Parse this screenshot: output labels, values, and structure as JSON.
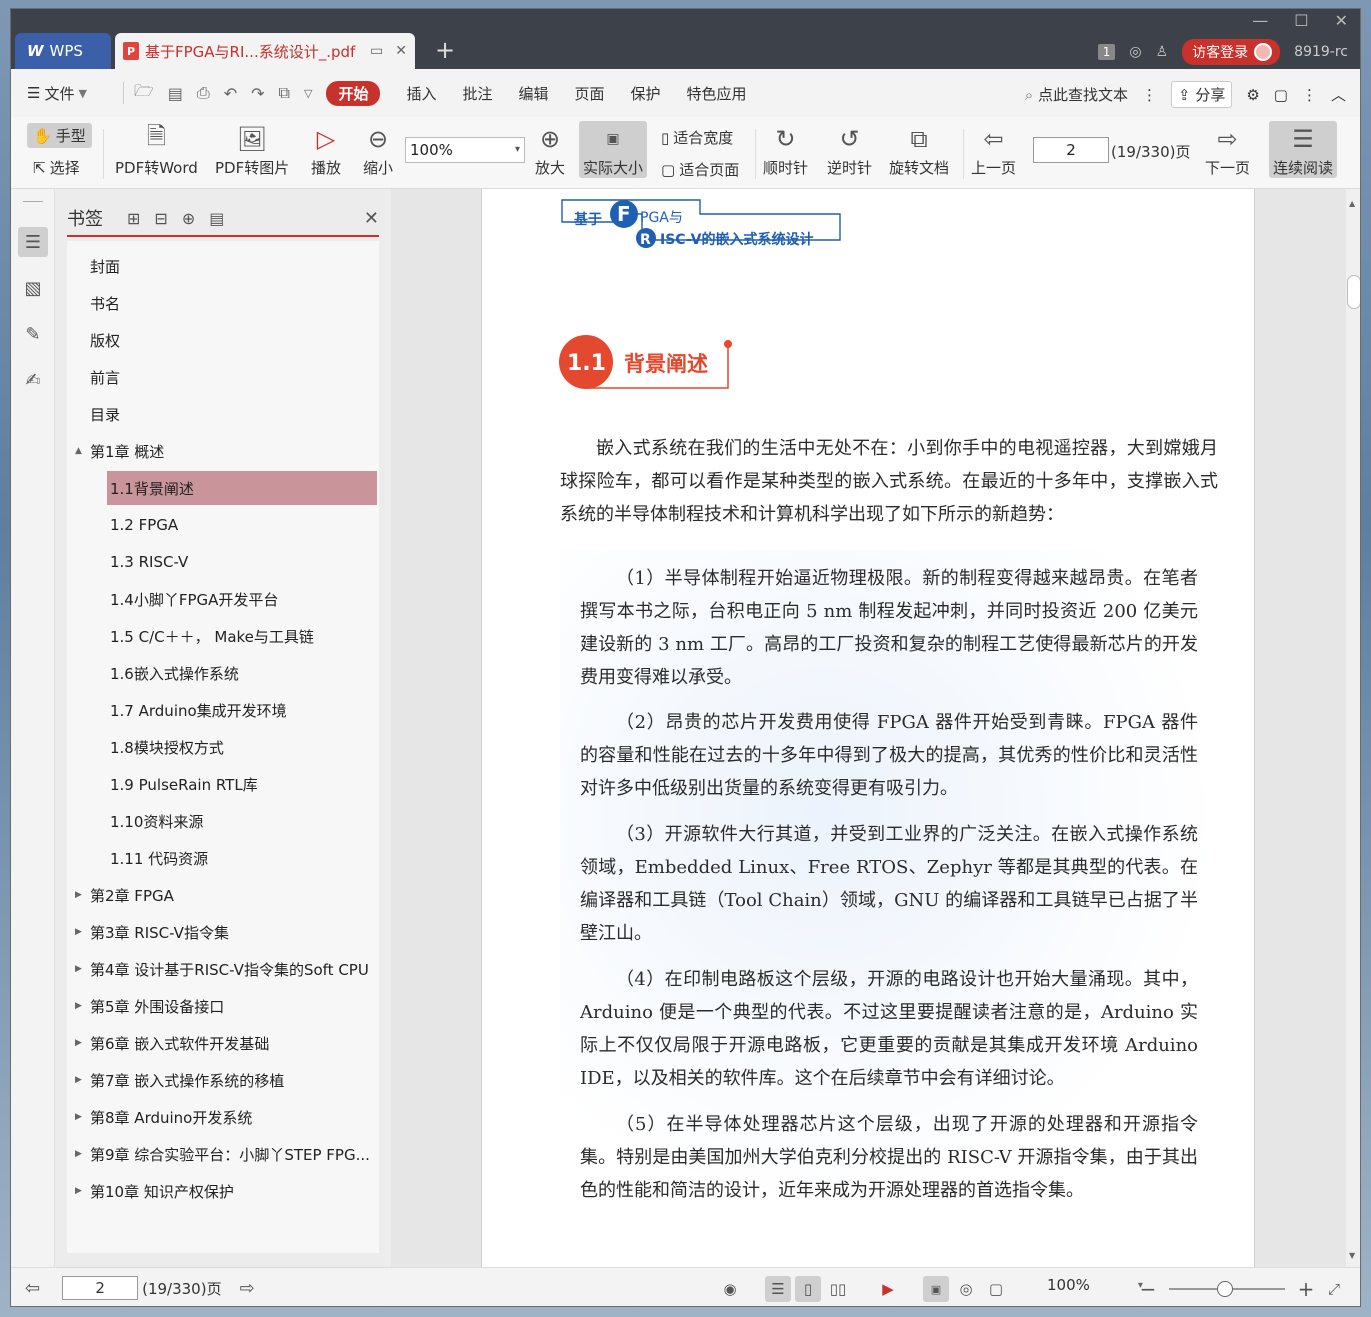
{
  "tabs": {
    "app_label": "WPS",
    "doc_label": "基于FPGA与RI...系统设计_.pdf",
    "page_badge": "1",
    "login_label": "访客登录",
    "user_label": "8919-rc"
  },
  "menu": {
    "file_label": "文件",
    "items": [
      "开始",
      "插入",
      "批注",
      "编辑",
      "页面",
      "保护",
      "特色应用"
    ],
    "search_label": "点此查找文本",
    "share_label": "分享"
  },
  "ribbon": {
    "hand_label": "手型",
    "select_label": "选择",
    "pdf_to_word": "PDF转Word",
    "pdf_to_image": "PDF转图片",
    "play": "播放",
    "zoom_out": "缩小",
    "zoom_value": "100%",
    "zoom_in": "放大",
    "actual_size": "实际大小",
    "fit_width": "适合宽度",
    "fit_page": "适合页面",
    "rotate_cw": "顺时针",
    "rotate_ccw": "逆时针",
    "rotate_doc": "旋转文档",
    "prev_page": "上一页",
    "page_value": "2",
    "page_total": "(19/330)页",
    "next_page": "下一页",
    "continuous": "连续阅读"
  },
  "bookmarks": {
    "title": "书签",
    "items": [
      {
        "label": "封面",
        "level": 0,
        "expander": ""
      },
      {
        "label": "书名",
        "level": 0,
        "expander": ""
      },
      {
        "label": "版权",
        "level": 0,
        "expander": ""
      },
      {
        "label": "前言",
        "level": 0,
        "expander": ""
      },
      {
        "label": "目录",
        "level": 0,
        "expander": ""
      },
      {
        "label": "第1章  概述",
        "level": 0,
        "expander": "▲"
      },
      {
        "label": "1.1背景阐述",
        "level": 1,
        "expander": "",
        "selected": true
      },
      {
        "label": "1.2  FPGA",
        "level": 1,
        "expander": ""
      },
      {
        "label": "1.3  RISC-V",
        "level": 1,
        "expander": ""
      },
      {
        "label": "1.4小脚丫FPGA开发平台",
        "level": 1,
        "expander": ""
      },
      {
        "label": "1.5  C/C＋＋，  Make与工具链",
        "level": 1,
        "expander": ""
      },
      {
        "label": "1.6嵌入式操作系统",
        "level": 1,
        "expander": ""
      },
      {
        "label": "1.7  Arduino集成开发环境",
        "level": 1,
        "expander": ""
      },
      {
        "label": "1.8模块授权方式",
        "level": 1,
        "expander": ""
      },
      {
        "label": "1.9  PulseRain RTL库",
        "level": 1,
        "expander": ""
      },
      {
        "label": "1.10资料来源",
        "level": 1,
        "expander": ""
      },
      {
        "label": "1.11  代码资源",
        "level": 1,
        "expander": ""
      },
      {
        "label": "第2章  FPGA",
        "level": 0,
        "expander": "▶"
      },
      {
        "label": "第3章  RISC-V指令集",
        "level": 0,
        "expander": "▶"
      },
      {
        "label": "第4章  设计基于RISC-V指令集的Soft CPU",
        "level": 0,
        "expander": "▶"
      },
      {
        "label": "第5章  外围设备接口",
        "level": 0,
        "expander": "▶"
      },
      {
        "label": "第6章  嵌入式软件开发基础",
        "level": 0,
        "expander": "▶"
      },
      {
        "label": "第7章  嵌入式操作系统的移植",
        "level": 0,
        "expander": "▶"
      },
      {
        "label": "第8章  Arduino开发系统",
        "level": 0,
        "expander": "▶"
      },
      {
        "label": "第9章  综合实验平台：小脚丫STEP FPG...",
        "level": 0,
        "expander": "▶"
      },
      {
        "label": "第10章  知识产权保护",
        "level": 0,
        "expander": "▶"
      }
    ]
  },
  "page": {
    "header_prefix": "基于",
    "header_f": "F",
    "header_pga": "PGA与",
    "header_r": "R",
    "header_rest": "ISC-V的嵌入式系统设计",
    "section_number": "1.1",
    "section_title": "背景阐述",
    "intro": "嵌入式系统在我们的生活中无处不在：小到你手中的电视遥控器，大到嫦娥月球探险车，都可以看作是某种类型的嵌入式系统。在最近的十多年中，支撑嵌入式系统的半导体制程技术和计算机科学出现了如下所示的新趋势：",
    "items": [
      "（1）半导体制程开始逼近物理极限。新的制程变得越来越昂贵。在笔者撰写本书之际，台积电正向 5 nm 制程发起冲刺，并同时投资近 200 亿美元建设新的 3 nm 工厂。高昂的工厂投资和复杂的制程工艺使得最新芯片的开发费用变得难以承受。",
      "（2）昂贵的芯片开发费用使得 FPGA 器件开始受到青睐。FPGA 器件的容量和性能在过去的十多年中得到了极大的提高，其优秀的性价比和灵活性对许多中低级别出货量的系统变得更有吸引力。",
      "（3）开源软件大行其道，并受到工业界的广泛关注。在嵌入式操作系统领域，Embedded Linux、Free RTOS、Zephyr 等都是其典型的代表。在编译器和工具链（Tool Chain）领域，GNU 的编译器和工具链早已占据了半壁江山。",
      "（4）在印制电路板这个层级，开源的电路设计也开始大量涌现。其中，Arduino 便是一个典型的代表。不过这里要提醒读者注意的是，Arduino 实际上不仅仅局限于开源电路板，它更重要的贡献是其集成开发环境 Arduino IDE，以及相关的软件库。这个在后续章节中会有详细讨论。",
      "（5）在半导体处理器芯片这个层级，出现了开源的处理器和开源指令集。特别是由美国加州大学伯克利分校提出的 RISC-V 开源指令集，由于其出色的性能和简洁的设计，近年来成为开源处理器的首选指令集。"
    ]
  },
  "status": {
    "page_value": "2",
    "page_total": "(19/330)页",
    "zoom_value": "100%"
  },
  "colors": {
    "accent": "#c8312c",
    "selected_bookmark": "#c9949a",
    "header_blue": "#1f5fb4",
    "section_red": "#e4492f"
  }
}
